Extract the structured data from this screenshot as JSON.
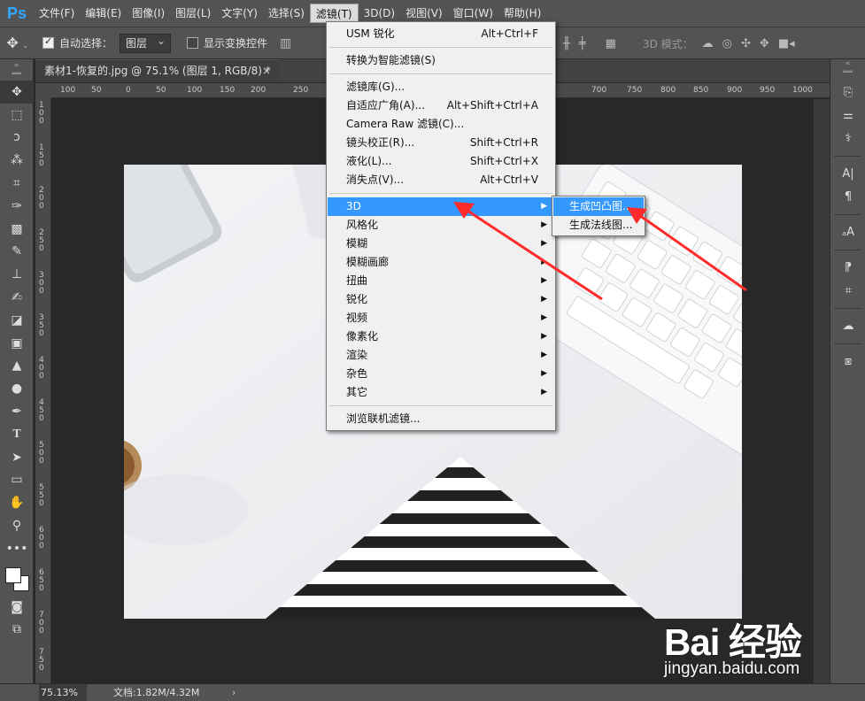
{
  "app": {
    "logo": "Ps"
  },
  "menubar": {
    "items": [
      "文件(F)",
      "编辑(E)",
      "图像(I)",
      "图层(L)",
      "文字(Y)",
      "选择(S)",
      "滤镜(T)",
      "3D(D)",
      "视图(V)",
      "窗口(W)",
      "帮助(H)"
    ],
    "active_index": 6
  },
  "options": {
    "auto_select_label": "自动选择：",
    "auto_select_checked": true,
    "target_value": "图层",
    "transform_label": "显示变换控件",
    "transform_checked": false,
    "mode3d_label": "3D 模式："
  },
  "document": {
    "tab_title": "素材1-恢复的.jpg @ 75.1% (图层 1, RGB/8) *",
    "close_glyph": "×"
  },
  "ruler": {
    "top_labels": [
      "100",
      "50",
      "0",
      "50",
      "100",
      "150",
      "200",
      "250",
      "700",
      "750",
      "800",
      "850",
      "900",
      "950",
      "1000"
    ],
    "left_labels": [
      "1 0 0",
      "1 5 0",
      "2 0 0",
      "2 5 0",
      "3 0 0",
      "3 5 0",
      "4 0 0",
      "4 5 0",
      "5 0 0",
      "5 5 0",
      "6 0 0",
      "6 5 0",
      "7 0 0",
      "7 5 0"
    ]
  },
  "filter_menu": {
    "items": [
      {
        "label": "USM 锐化",
        "shortcut": "Alt+Ctrl+F"
      },
      {
        "label": "转换为智能滤镜(S)",
        "shortcut": ""
      },
      {
        "label": "滤镜库(G)...",
        "shortcut": ""
      },
      {
        "label": "自适应广角(A)...",
        "shortcut": "Alt+Shift+Ctrl+A"
      },
      {
        "label": "Camera Raw 滤镜(C)...",
        "shortcut": "Shift+Ctrl+A"
      },
      {
        "label": "镜头校正(R)...",
        "shortcut": "Shift+Ctrl+R"
      },
      {
        "label": "液化(L)...",
        "shortcut": "Shift+Ctrl+X"
      },
      {
        "label": "消失点(V)...",
        "shortcut": "Alt+Ctrl+V"
      },
      {
        "label": "3D",
        "submenu": true
      },
      {
        "label": "风格化",
        "submenu": true
      },
      {
        "label": "模糊",
        "submenu": true
      },
      {
        "label": "模糊画廊",
        "submenu": true
      },
      {
        "label": "扭曲",
        "submenu": true
      },
      {
        "label": "锐化",
        "submenu": true
      },
      {
        "label": "视频",
        "submenu": true
      },
      {
        "label": "像素化",
        "submenu": true
      },
      {
        "label": "渲染",
        "submenu": true
      },
      {
        "label": "杂色",
        "submenu": true
      },
      {
        "label": "其它",
        "submenu": true
      },
      {
        "label": "浏览联机滤镜...",
        "shortcut": ""
      }
    ],
    "highlighted": "3D"
  },
  "submenu_3d": {
    "items": [
      "生成凹凸图...",
      "生成法线图..."
    ],
    "highlighted": "生成凹凸图..."
  },
  "status": {
    "zoom": "75.13%",
    "doc_info": "文档:1.82M/4.32M",
    "arrow": "›"
  },
  "watermark": {
    "brand": "Bai 经验",
    "url": "jingyan.baidu.com"
  },
  "colors": {
    "menu_highlight": "#3399ff",
    "annotation_arrow": "#ff2a2a",
    "ps_blue": "#31a8ff"
  },
  "icons": {
    "left_tools": [
      "move-icon",
      "marquee-icon",
      "lasso-icon",
      "magic-wand-icon",
      "crop-icon",
      "eyedropper-icon",
      "healing-brush-icon",
      "brush-icon",
      "clone-stamp-icon",
      "history-brush-icon",
      "eraser-icon",
      "gradient-icon",
      "blur-icon",
      "dodge-icon",
      "pen-icon",
      "type-icon",
      "path-selection-icon",
      "rectangle-icon",
      "hand-icon",
      "zoom-icon",
      "more-tools-icon"
    ],
    "right_panels": [
      "history-icon",
      "adjustments-icon",
      "brush-settings-icon",
      "character-icon",
      "paragraph-icon",
      "character-styles-icon",
      "paragraph-styles-icon",
      "crop-panel-icon",
      "libraries-icon",
      "3d-panel-icon"
    ]
  }
}
